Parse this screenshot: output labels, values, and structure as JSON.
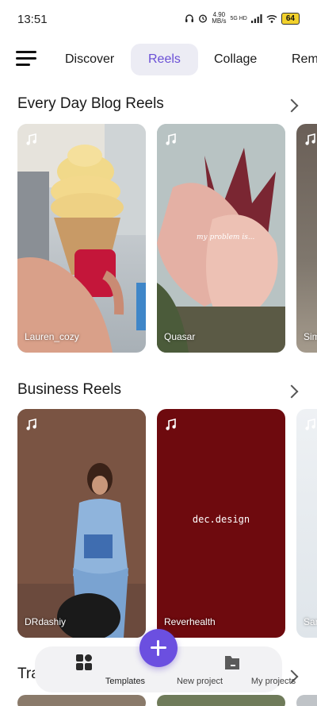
{
  "status": {
    "time": "13:51",
    "speed_value": "4.90",
    "speed_unit": "MB/s",
    "network": "5G HD",
    "battery": "64"
  },
  "nav": {
    "tabs": [
      {
        "label": "Discover"
      },
      {
        "label": "Reels"
      },
      {
        "label": "Collage"
      },
      {
        "label": "Rem"
      }
    ],
    "active_tab": "Reels"
  },
  "sections": [
    {
      "title": "Every Day Blog Reels",
      "cards": [
        {
          "label": "Lauren_cozy"
        },
        {
          "label": "Quasar",
          "overlay_text": "my problem is..."
        },
        {
          "label": "Sim"
        }
      ]
    },
    {
      "title": "Business Reels",
      "cards": [
        {
          "label": "DRdashiy"
        },
        {
          "label": "Reverhealth",
          "overlay_text": "dec.design"
        },
        {
          "label": "Sar"
        }
      ]
    },
    {
      "title": "Tra"
    }
  ],
  "bottom_nav": {
    "templates": "Templates",
    "new_project": "New project",
    "my_projects": "My projects"
  },
  "colors": {
    "accent": "#6b4fe0",
    "active_tab_bg": "#ececf4",
    "reverhealth_bg": "#6e0a0e"
  }
}
